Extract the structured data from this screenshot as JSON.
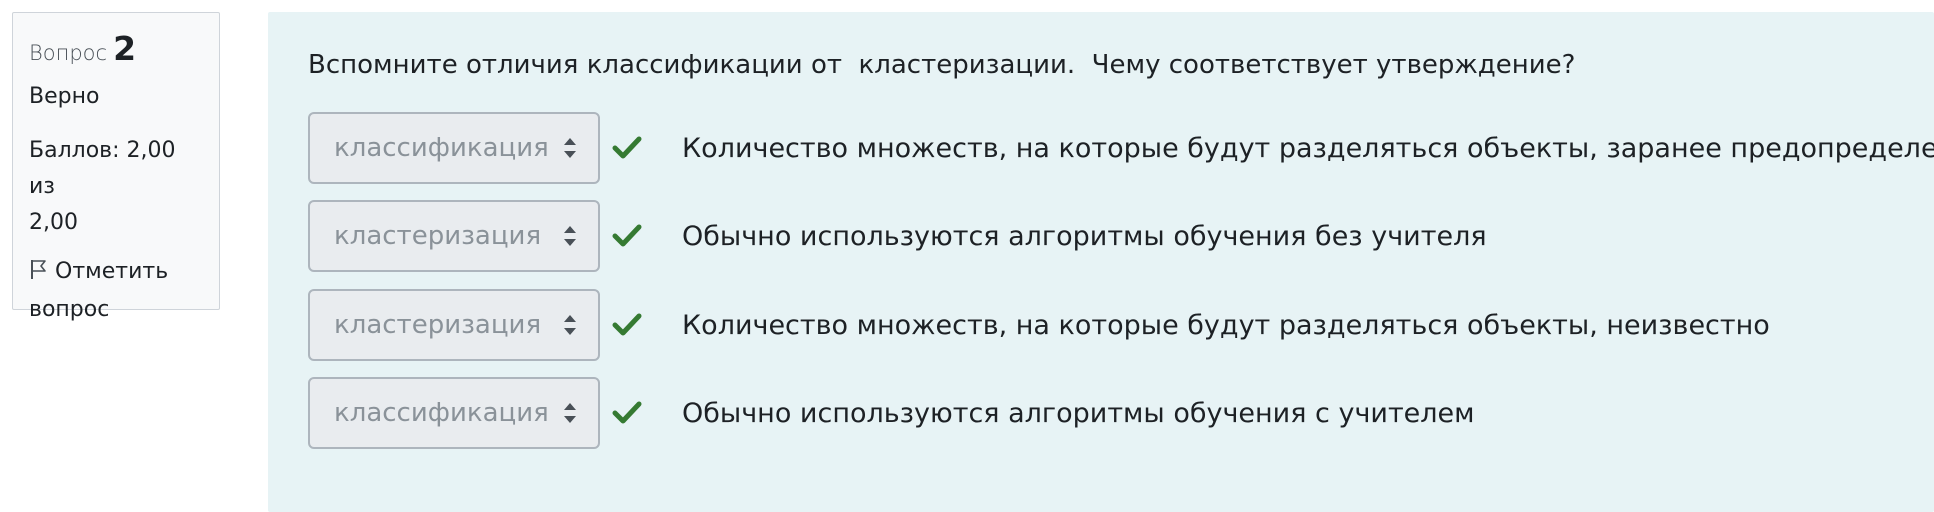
{
  "info": {
    "question_label": "Вопрос",
    "question_number": "2",
    "state": "Верно",
    "grade_line1": "Баллов: 2,00 из",
    "grade_line2": "2,00",
    "flag_line1": "Отметить",
    "flag_line2": "вопрос"
  },
  "question": {
    "text": "Вспомните отличия классификации от  кластеризации.  Чему соответствует утверждение?",
    "rows": [
      {
        "selected": "классификация",
        "statement": "Количество множеств, на которые будут разделяться объекты, заранее предопределено"
      },
      {
        "selected": "кластеризация",
        "statement": "Обычно используются алгоритмы обучения без учителя"
      },
      {
        "selected": "кластеризация",
        "statement": "Количество множеств, на которые будут разделяться объекты, неизвестно"
      },
      {
        "selected": "классификация",
        "statement": "Обычно используются алгоритмы обучения с учителем"
      }
    ]
  },
  "colors": {
    "content_bg": "#e7f3f5",
    "check": "#357a32",
    "info_bg": "#f8f9fa"
  },
  "icons": {
    "flag": "flag-icon",
    "check": "check-icon",
    "select_arrows": "chevron-updown-icon"
  }
}
